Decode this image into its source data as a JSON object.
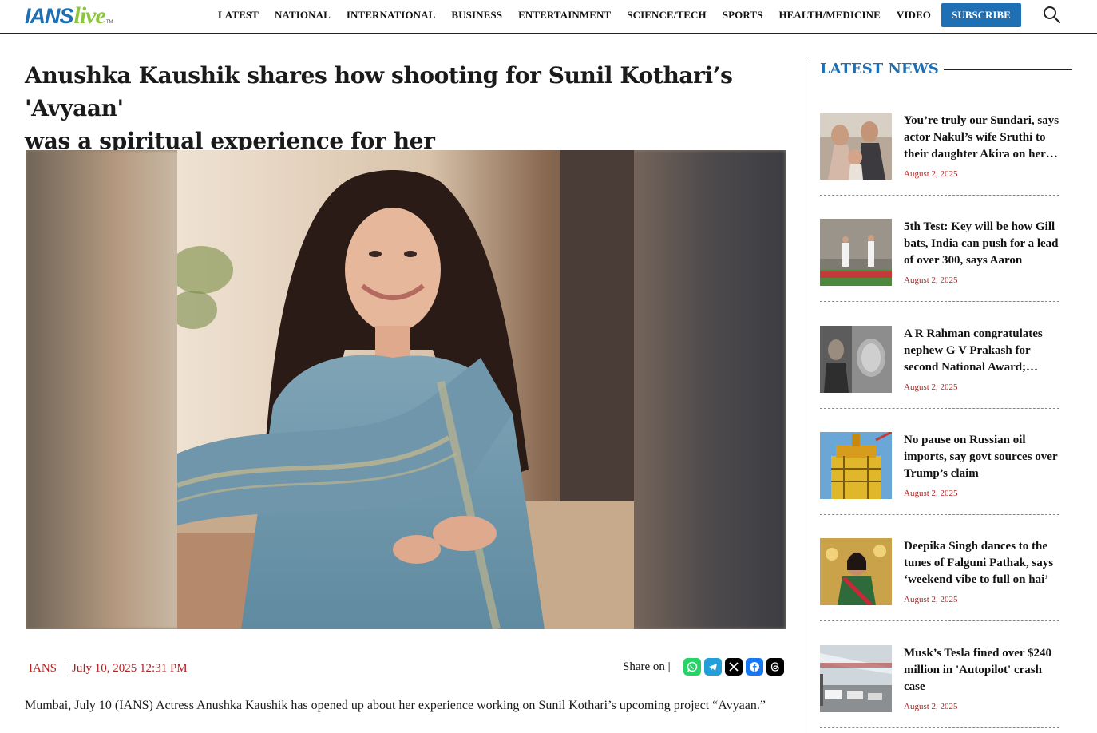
{
  "logo": {
    "brand": "IANS",
    "brand_suffix": "live",
    "tm": "TM"
  },
  "nav": {
    "items": [
      "LATEST",
      "NATIONAL",
      "INTERNATIONAL",
      "BUSINESS",
      "ENTERTAINMENT",
      "SCIENCE/TECH",
      "SPORTS",
      "HEALTH/MEDICINE",
      "VIDEO"
    ],
    "subscribe_label": "SUBSCRIBE",
    "search_icon": "search-icon"
  },
  "article": {
    "headline_line1": "Anushka Kaushik shares how shooting for Sunil Kothari’s 'Avyaan'",
    "headline_line2": "was a spiritual experience for her",
    "author": "IANS",
    "date": "July 10, 2025 12:31 PM",
    "share_label": "Share on |",
    "share_icons": [
      "whatsapp-icon",
      "telegram-icon",
      "x-icon",
      "facebook-icon",
      "threads-icon"
    ],
    "lede": "Mumbai, July 10 (IANS) Actress Anushka Kaushik has opened up about her experience working on Sunil Kothari’s upcoming project “Avyaan.”"
  },
  "sidebar": {
    "title": "LATEST NEWS",
    "items": [
      {
        "title": "You’re truly our Sundari, says actor Nakul’s wife Sruthi to their daughter Akira on her…",
        "date": "August 2, 2025"
      },
      {
        "title": "5th Test: Key will be how Gill bats, India can push for a lead of over 300, says Aaron",
        "date": "August 2, 2025"
      },
      {
        "title": "A R Rahman congratulates nephew G V Prakash for second National Award;…",
        "date": "August 2, 2025"
      },
      {
        "title": "No pause on Russian oil imports, say govt sources over Trump’s claim",
        "date": "August 2, 2025"
      },
      {
        "title": "Deepika Singh dances to the tunes of Falguni Pathak, says ‘weekend vibe to full on hai’",
        "date": "August 2, 2025"
      },
      {
        "title": "Musk’s Tesla fined over $240 million in 'Autopilot' crash case",
        "date": "August 2, 2025"
      }
    ]
  },
  "colors": {
    "brand_blue": "#1f6fb5",
    "brand_green": "#8cc63f",
    "date_red": "#b22222"
  }
}
